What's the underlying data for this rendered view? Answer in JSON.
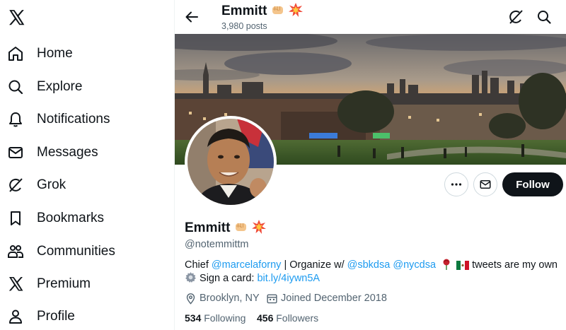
{
  "nav": {
    "logo_icon": "x-logo-icon",
    "items": [
      {
        "label": "Home",
        "icon": "home-icon"
      },
      {
        "label": "Explore",
        "icon": "search-icon"
      },
      {
        "label": "Notifications",
        "icon": "bell-icon"
      },
      {
        "label": "Messages",
        "icon": "envelope-icon"
      },
      {
        "label": "Grok",
        "icon": "grok-icon"
      },
      {
        "label": "Bookmarks",
        "icon": "bookmark-icon"
      },
      {
        "label": "Communities",
        "icon": "communities-icon"
      },
      {
        "label": "Premium",
        "icon": "x-logo-icon"
      },
      {
        "label": "Profile",
        "icon": "person-icon"
      }
    ]
  },
  "header": {
    "name": "Emmitt",
    "post_count": "3,980 posts"
  },
  "profile": {
    "name": "Emmitt",
    "handle": "@notemmittm",
    "follow_label": "Follow",
    "bio": {
      "t1": "Chief ",
      "m1": "@marcelaforny",
      "t2": " | Organize w/ ",
      "m2": "@sbkdsa",
      "t3": " ",
      "m3": "@nycdsa",
      "t4": " tweets are my own",
      "t5": "Sign a card: ",
      "link": "bit.ly/4iywn5A"
    },
    "location": "Brooklyn, NY",
    "joined": "Joined December 2018",
    "following_count": "534",
    "following_label": "Following",
    "followers_count": "456",
    "followers_label": "Followers"
  },
  "colors": {
    "accent": "#1d9bf0",
    "text": "#0f1419",
    "muted": "#536471",
    "follow_bg": "#0f1419"
  }
}
